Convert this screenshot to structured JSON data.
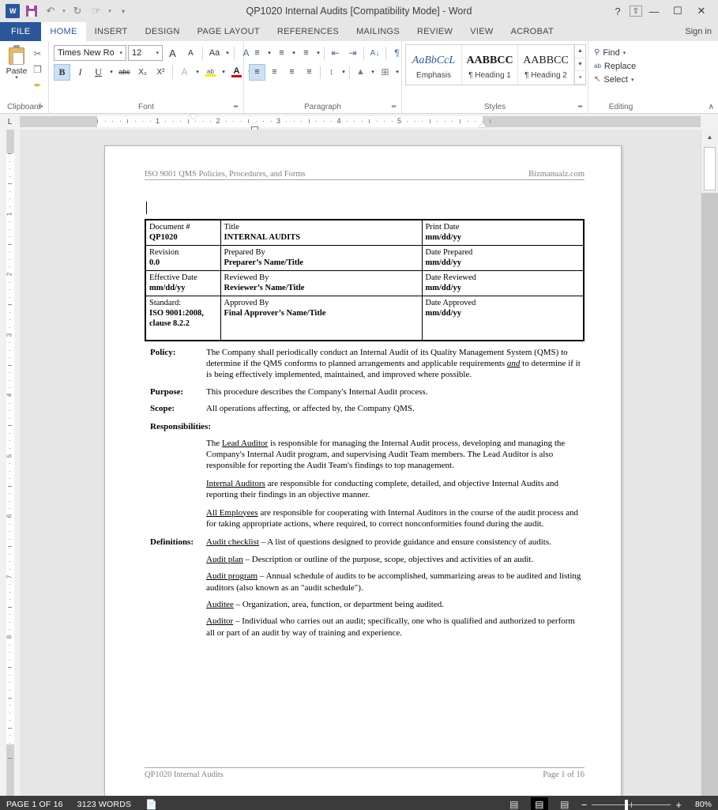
{
  "window": {
    "title": "QP1020 Internal Audits [Compatibility Mode] - Word",
    "quick_access": [
      {
        "name": "word-logo",
        "glyph": "W"
      },
      {
        "name": "save-icon",
        "glyph": ""
      },
      {
        "name": "undo-icon",
        "glyph": "↶"
      },
      {
        "name": "redo-icon",
        "glyph": "↻"
      },
      {
        "name": "touch-mode-icon",
        "glyph": "☞"
      },
      {
        "name": "customize-qat-icon",
        "glyph": "≡"
      }
    ],
    "controls": [
      {
        "name": "help-button",
        "glyph": "?"
      },
      {
        "name": "ribbon-display-options-button",
        "glyph": "⬆"
      },
      {
        "name": "minimize-button",
        "glyph": "—"
      },
      {
        "name": "restore-button",
        "glyph": "☐"
      },
      {
        "name": "close-button",
        "glyph": "✕"
      }
    ],
    "sign_in": "Sign in"
  },
  "ribbon": {
    "file_tab": "FILE",
    "tabs": [
      {
        "label": "HOME",
        "active": true
      },
      {
        "label": "INSERT",
        "active": false
      },
      {
        "label": "DESIGN",
        "active": false
      },
      {
        "label": "PAGE LAYOUT",
        "active": false
      },
      {
        "label": "REFERENCES",
        "active": false
      },
      {
        "label": "MAILINGS",
        "active": false
      },
      {
        "label": "REVIEW",
        "active": false
      },
      {
        "label": "VIEW",
        "active": false
      },
      {
        "label": "ACROBAT",
        "active": false
      }
    ],
    "clipboard": {
      "label": "Clipboard",
      "paste_label": "Paste",
      "cut": "✂",
      "copy": "❐",
      "format_painter": "✒"
    },
    "font": {
      "label": "Font",
      "font_name": "Times New Ro",
      "font_size": "12",
      "grow_font": "A",
      "shrink_font": "A",
      "change_case": "Aa",
      "clear_formatting": "A",
      "bold": "B",
      "italic": "I",
      "underline": "U",
      "strikethrough": "abc",
      "subscript": "X₂",
      "superscript": "X²",
      "text_effects": "A",
      "highlight": "ab",
      "font_color": "A"
    },
    "paragraph": {
      "label": "Paragraph",
      "bullets": "≡",
      "numbering": "≡",
      "multilevel": "≡",
      "decrease_indent": "⇤",
      "increase_indent": "⇥",
      "sort": "A↓",
      "show_marks": "¶",
      "align_left": "≡",
      "align_center": "≡",
      "align_right": "≡",
      "justify": "≡",
      "line_spacing": "↕",
      "shading": "▲",
      "borders": "⊞"
    },
    "styles": {
      "label": "Styles",
      "items": [
        {
          "preview": "AaBbCcL",
          "name": "Emphasis"
        },
        {
          "preview": "AABBCC",
          "name": "¶ Heading 1"
        },
        {
          "preview": "AABBCC",
          "name": "¶ Heading 2"
        }
      ],
      "scroll_up": "▲",
      "scroll_down": "▼",
      "more": "≡"
    },
    "editing": {
      "label": "Editing",
      "find": "Find",
      "replace": "Replace",
      "select": "Select",
      "find_icon": "🔍",
      "replace_icon": "ab",
      "select_icon": "↖"
    },
    "collapse_icon": "∧",
    "dialog_launcher": "⬌"
  },
  "ruler": {
    "tab_stop_marker": "L",
    "h_numbers": [
      "1",
      "2",
      "3",
      "4",
      "5"
    ],
    "v_numbers": [
      "1",
      "2",
      "3",
      "4",
      "5",
      "6",
      "7",
      "8"
    ]
  },
  "document": {
    "header": {
      "left": "ISO 9001 QMS Policies, Procedures, and Forms",
      "right": "Bizmanualz.com"
    },
    "info_table": [
      [
        {
          "label": "Document #",
          "value": "QP1020"
        },
        {
          "label": "Title",
          "value": "INTERNAL AUDITS"
        },
        {
          "label": "Print Date",
          "value": "mm/dd/yy"
        }
      ],
      [
        {
          "label": "Revision",
          "value": "0.0"
        },
        {
          "label": "Prepared By",
          "value": "Preparer’s Name/Title"
        },
        {
          "label": "Date Prepared",
          "value": "mm/dd/yy"
        }
      ],
      [
        {
          "label": "Effective Date",
          "value": "mm/dd/yy"
        },
        {
          "label": "Reviewed By",
          "value": "Reviewer’s Name/Title"
        },
        {
          "label": "Date Reviewed",
          "value": "mm/dd/yy"
        }
      ],
      [
        {
          "label": "Standard:",
          "value": "ISO 9001:2008, clause 8.2.2"
        },
        {
          "label": "Approved By",
          "value": "Final Approver’s Name/Title"
        },
        {
          "label": "Date Approved",
          "value": "mm/dd/yy"
        }
      ]
    ],
    "sections": {
      "policy_label": "Policy:",
      "policy_text_1": "The Company shall periodically conduct an Internal Audit of its Quality Management System (QMS) to determine if the QMS conforms to planned arrangements and applicable requirements ",
      "policy_italic": "and",
      "policy_text_2": " to determine if it is being effectively implemented, maintained, and improved where possible.",
      "purpose_label": "Purpose:",
      "purpose_text": "This procedure describes the Company's Internal Audit process.",
      "scope_label": "Scope:",
      "scope_text": "All operations affecting, or affected by, the Company QMS.",
      "responsibilities_label": "Responsibilities:",
      "resp_1_term": "Lead Auditor",
      "resp_1_pre": "The ",
      "resp_1_text": " is responsible for managing the Internal Audit process, developing and managing the Company's Internal Audit program, and supervising Audit Team members.  The Lead Auditor is also responsible for reporting the Audit Team's findings to top management.",
      "resp_2_term": "Internal Auditors",
      "resp_2_text": " are responsible for conducting complete, detailed, and objective Internal Audits and reporting their findings in an objective manner.",
      "resp_3_term": "All Employees",
      "resp_3_text": " are responsible for cooperating with Internal Auditors in the course of the audit process and for taking appropriate actions, where required, to correct nonconformities found during the audit.",
      "definitions_label": "Definitions:",
      "definitions": [
        {
          "term": "Audit checklist",
          "text": " – A list of questions designed to provide guidance and ensure consistency of audits."
        },
        {
          "term": "Audit plan",
          "text": " – Description or outline of the purpose, scope, objectives and activities of an audit."
        },
        {
          "term": "Audit program",
          "text": " – Annual schedule of audits to be accomplished, summarizing areas to be audited and listing auditors (also known as an \"audit schedule\")."
        },
        {
          "term": "Auditee",
          "text": " – Organization, area, function, or department being audited."
        },
        {
          "term": "Auditor",
          "text": " – Individual who carries out an audit; specifically, one who is qualified and authorized to perform all or part of an audit by way of training and experience."
        }
      ]
    },
    "footer": {
      "left": "QP1020 Internal Audits",
      "right": "Page 1 of 16"
    }
  },
  "status_bar": {
    "page_count": "PAGE 1 OF 16",
    "word_count": "3123 WORDS",
    "proofing_icon": "⌧",
    "view_read": "▤",
    "view_print": "▤",
    "view_web": "▤",
    "zoom_out": "−",
    "zoom_in": "+",
    "zoom_level": "80%"
  },
  "colors": {
    "word_blue": "#2b579a",
    "ribbon_bg": "#e6e6e6",
    "status_bg": "#3b3b3b",
    "canvas_bg": "#e6e6e6"
  }
}
